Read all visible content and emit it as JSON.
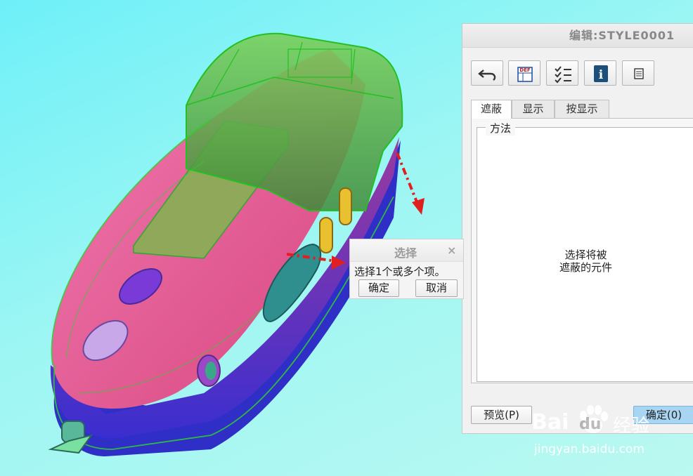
{
  "dialog": {
    "title": "编辑:STYLE0001",
    "toolbar": [
      {
        "icon": "undo-icon"
      },
      {
        "icon": "def-layer-icon",
        "icon_text": "DEF"
      },
      {
        "icon": "checklist-icon"
      },
      {
        "icon": "info-icon",
        "icon_text": "i"
      },
      {
        "icon": "note-icon"
      }
    ],
    "tabs": [
      "遮蔽",
      "显示",
      "按显示"
    ],
    "active_tab": "遮蔽",
    "method_label": "方法",
    "message_line1": "选择将被",
    "message_line2": "遮蔽的元件",
    "preview_button": "预览(P)",
    "ok_button": "确定(0)"
  },
  "select_popup": {
    "title": "选择",
    "close_glyph": "×",
    "prompt": "选择1个或多个项。",
    "ok_button": "确定",
    "cancel_button": "取消"
  },
  "watermark": {
    "brand_left": "Bai",
    "brand_right": "du",
    "brand_suffix": "经验",
    "url": "jingyan.baidu.com"
  },
  "colors": {
    "viewport_bg": "#8ff4f4",
    "model_pink": "#e0508a",
    "model_purple": "#7a3aa8",
    "model_blue": "#3030c8",
    "wireframe_green": "#2ec82e",
    "arrow_red": "#e02020",
    "ok_button_bg": "#a8d6f2"
  }
}
